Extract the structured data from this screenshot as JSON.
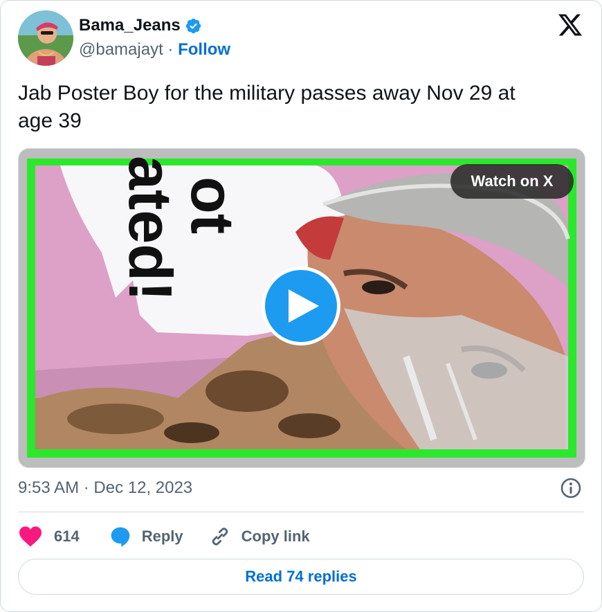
{
  "author": {
    "name": "Bama_Jeans",
    "handle": "@bamajayt",
    "separator": " · ",
    "follow_label": "Follow",
    "verified": true
  },
  "tweet": {
    "text": "Jab Poster Boy for the military passes away Nov 29 at\nage 39",
    "timestamp": "9:53 AM · Dec 12, 2023"
  },
  "media": {
    "watch_label": "Watch on X",
    "sign_text": "ot\nated!",
    "icon": "play-icon"
  },
  "actions": {
    "like_count": "614",
    "reply_label": "Reply",
    "copy_label": "Copy link"
  },
  "read_replies_label": "Read 74 replies",
  "colors": {
    "link_blue": "#006fd6",
    "play_blue": "#1d9bf0",
    "like_pink": "#f91880",
    "frame_green": "#28e02a",
    "muted_gray": "#536471"
  }
}
